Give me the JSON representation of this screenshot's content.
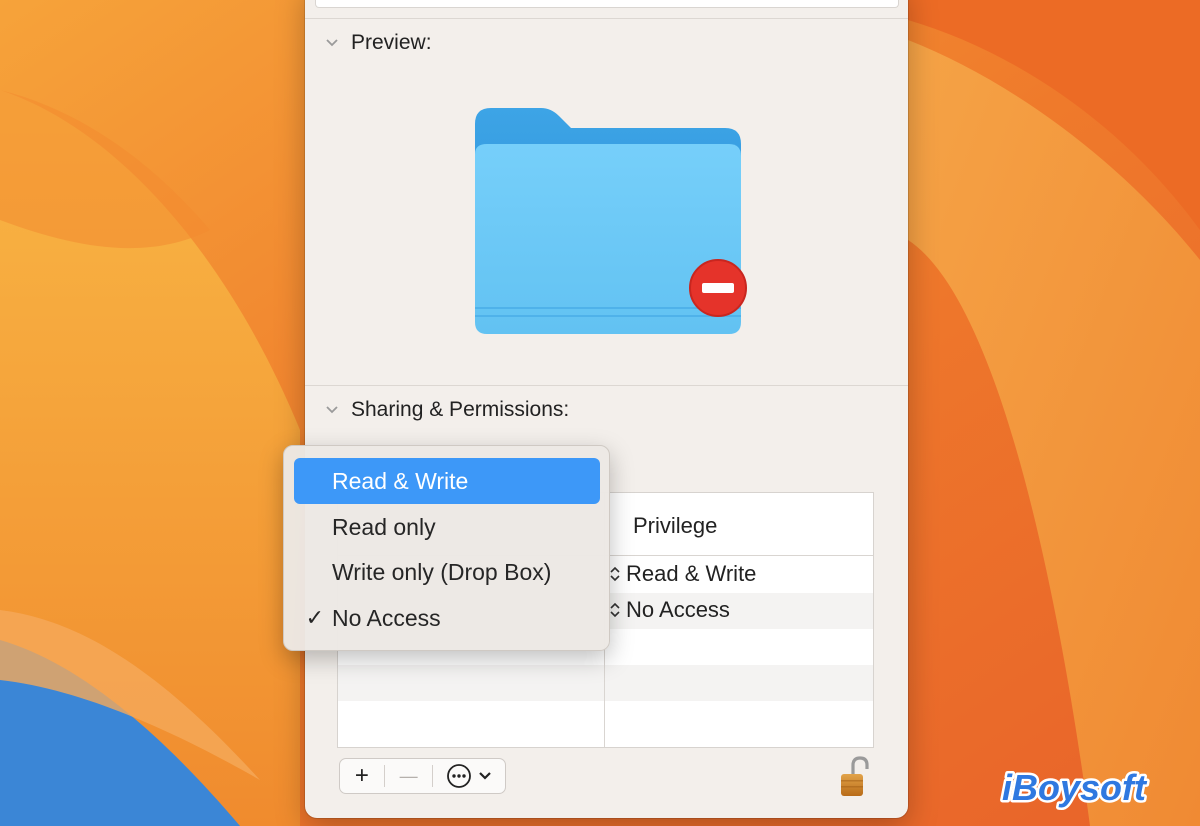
{
  "window": {
    "preview_section": {
      "title": "Preview:"
    },
    "sharing_section": {
      "title": "Sharing & Permissions:"
    }
  },
  "permissions_table": {
    "header": {
      "privilege": "Privilege"
    },
    "rows": [
      {
        "privilege": "Read & Write"
      },
      {
        "privilege": "No Access"
      }
    ]
  },
  "privilege_menu": {
    "items": [
      {
        "label": "Read & Write",
        "highlighted": true,
        "checked": false
      },
      {
        "label": "Read only",
        "highlighted": false,
        "checked": false
      },
      {
        "label": "Write only (Drop Box)",
        "highlighted": false,
        "checked": false
      },
      {
        "label": "No Access",
        "highlighted": false,
        "checked": true
      }
    ],
    "check_mark": "✓"
  },
  "toolbar": {
    "add_label": "+",
    "remove_label": "—",
    "action_icon": "ellipsis-circle-icon"
  },
  "watermark": {
    "text": "iBoysoft"
  },
  "colors": {
    "menu_highlight": "#3d98f8",
    "folder_blue": "#6ccaf7",
    "no_entry_red": "#e5332a",
    "watermark_blue": "#2f78e0"
  }
}
